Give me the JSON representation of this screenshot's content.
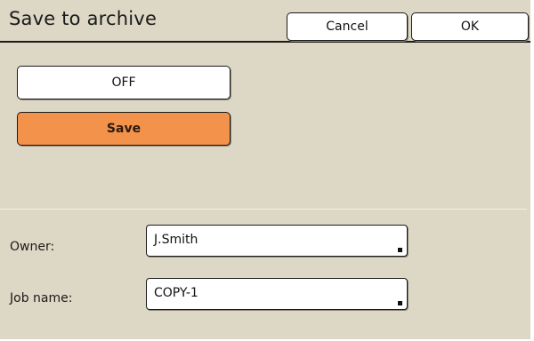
{
  "header": {
    "title": "Save to archive",
    "cancel_label": "Cancel",
    "ok_label": "OK"
  },
  "options": {
    "off_label": "OFF",
    "save_label": "Save",
    "selected": "Save"
  },
  "form": {
    "owner_label": "Owner:",
    "owner_value": "J.Smith",
    "job_label": "Job name:",
    "job_value": "COPY-1"
  },
  "colors": {
    "background": "#ddd7c5",
    "selected_button": "#f3924a"
  },
  "icons": {
    "field_marker": "input-marker-icon"
  }
}
